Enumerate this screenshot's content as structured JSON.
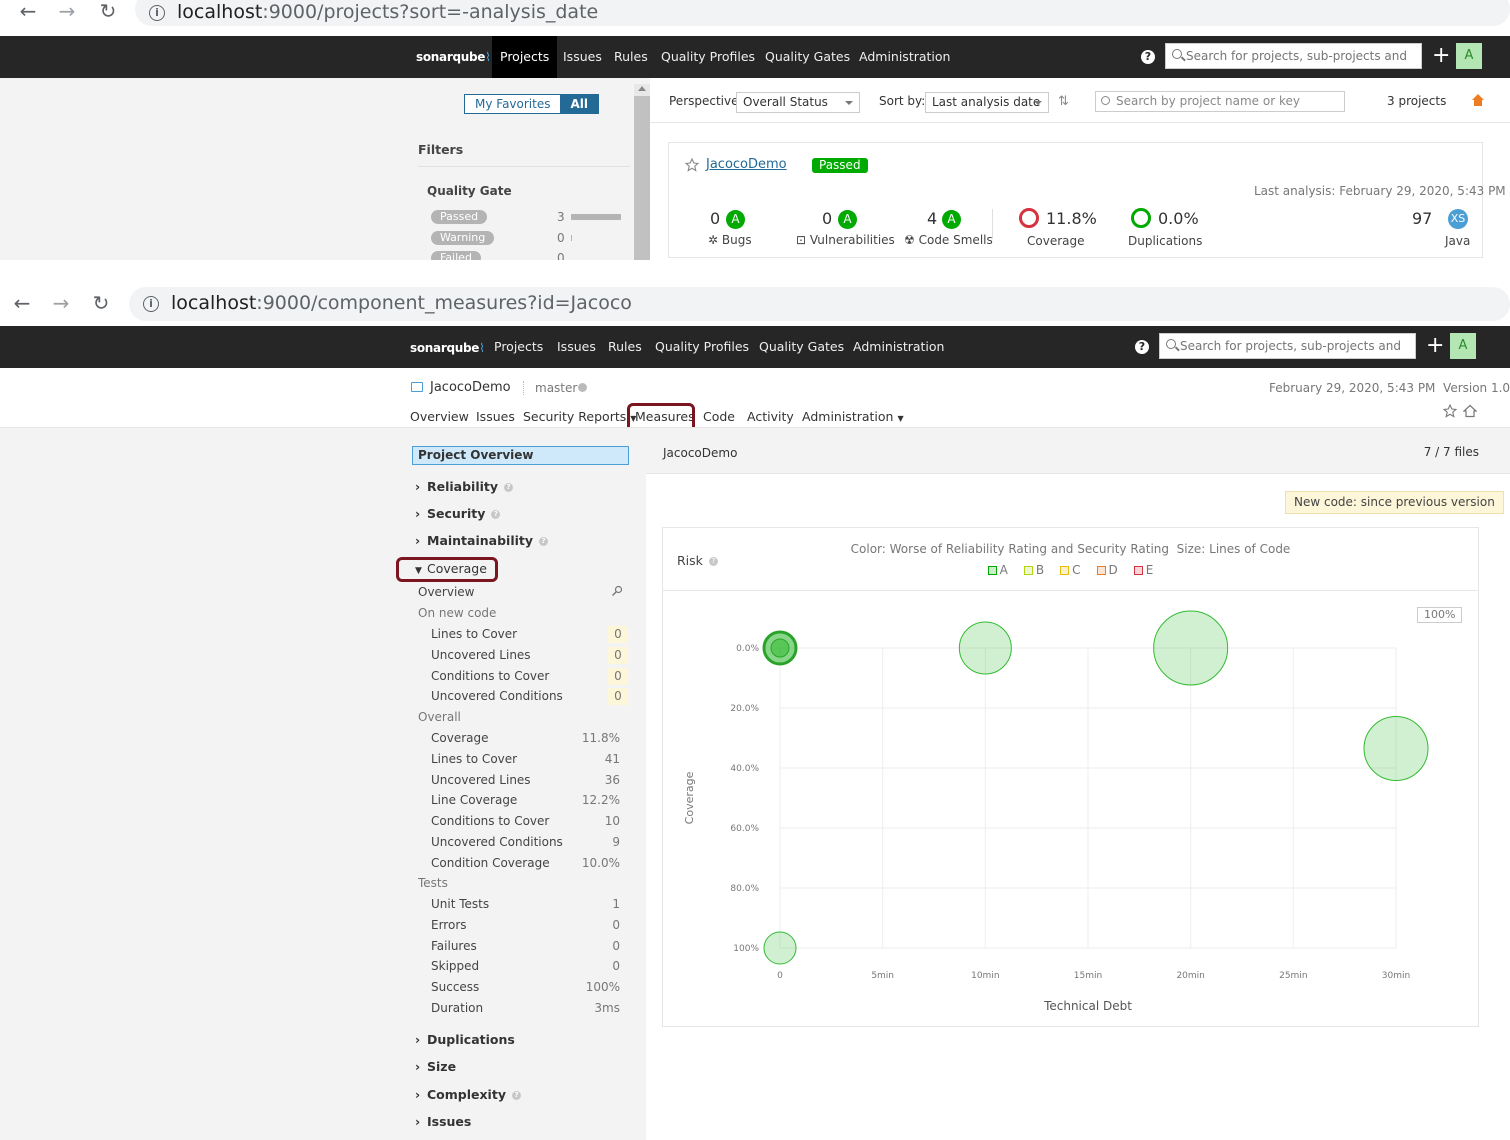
{
  "browser1": {
    "url_host": "localhost",
    "url_rest": ":9000/projects?sort=-analysis_date"
  },
  "browser2": {
    "url_host": "localhost",
    "url_rest": ":9000/component_measures?id=Jacoco"
  },
  "topnav": {
    "logo": "sonarqube",
    "items": [
      "Projects",
      "Issues",
      "Rules",
      "Quality Profiles",
      "Quality Gates",
      "Administration"
    ],
    "active": "Projects",
    "help": "?",
    "search_placeholder": "Search for projects, sub-projects and files",
    "plus": "+",
    "avatar": "A"
  },
  "projects_page": {
    "toggle": {
      "favorites": "My Favorites",
      "all": "All"
    },
    "filters_title": "Filters",
    "quality_gate_title": "Quality Gate",
    "quality_gate_filters": [
      {
        "label": "Passed",
        "count": "3"
      },
      {
        "label": "Warning",
        "count": "0"
      },
      {
        "label": "Failed",
        "count": "0"
      }
    ],
    "perspective_label": "Perspective:",
    "perspective_value": "Overall Status",
    "sort_label": "Sort by:",
    "sort_value": "Last analysis date",
    "search_placeholder": "Search by project name or key",
    "project_count": "3 projects",
    "project": {
      "name": "JacocoDemo",
      "gate": "Passed",
      "last_analysis": "Last analysis: February 29, 2020, 5:43 PM",
      "bugs": {
        "value": "0",
        "rating": "A",
        "label": "Bugs"
      },
      "vulnerabilities": {
        "value": "0",
        "rating": "A",
        "label": "Vulnerabilities"
      },
      "code_smells": {
        "value": "4",
        "rating": "A",
        "label": "Code Smells"
      },
      "coverage": {
        "value": "11.8%",
        "label": "Coverage"
      },
      "duplications": {
        "value": "0.0%",
        "label": "Duplications"
      },
      "size": {
        "value": "97",
        "badge": "XS",
        "language": "Java"
      }
    }
  },
  "measures_page": {
    "project_name": "JacocoDemo",
    "branch": "master",
    "analysis_info": "February 29, 2020, 5:43 PM  Version 1.0",
    "subnav": [
      "Overview",
      "Issues",
      "Security Reports",
      "Measures",
      "Code",
      "Activity",
      "Administration"
    ],
    "active_tab": "Measures",
    "project_overview": "Project Overview",
    "domains": {
      "reliability": "Reliability",
      "security": "Security",
      "maintainability": "Maintainability",
      "coverage": "Coverage",
      "duplications": "Duplications",
      "size": "Size",
      "complexity": "Complexity",
      "issues": "Issues"
    },
    "coverage_overview": "Overview",
    "on_new_code": "On new code",
    "new_code_metrics": [
      {
        "label": "Lines to Cover",
        "value": "0"
      },
      {
        "label": "Uncovered Lines",
        "value": "0"
      },
      {
        "label": "Conditions to Cover",
        "value": "0"
      },
      {
        "label": "Uncovered Conditions",
        "value": "0"
      }
    ],
    "overall_title": "Overall",
    "overall_metrics": [
      {
        "label": "Coverage",
        "value": "11.8%"
      },
      {
        "label": "Lines to Cover",
        "value": "41"
      },
      {
        "label": "Uncovered Lines",
        "value": "36"
      },
      {
        "label": "Line Coverage",
        "value": "12.2%"
      },
      {
        "label": "Conditions to Cover",
        "value": "10"
      },
      {
        "label": "Uncovered Conditions",
        "value": "9"
      },
      {
        "label": "Condition Coverage",
        "value": "10.0%"
      }
    ],
    "tests_title": "Tests",
    "tests_metrics": [
      {
        "label": "Unit Tests",
        "value": "1"
      },
      {
        "label": "Errors",
        "value": "0"
      },
      {
        "label": "Failures",
        "value": "0"
      },
      {
        "label": "Skipped",
        "value": "0"
      },
      {
        "label": "Success",
        "value": "100%"
      },
      {
        "label": "Duration",
        "value": "3ms"
      }
    ],
    "breadcrumb": "JacocoDemo",
    "files_count": "7 / 7 files",
    "new_code_badge": "New code: since previous version",
    "risk_title": "Risk",
    "legend_caption": "Color: Worse of Reliability Rating and Security Rating  Size: Lines of Code",
    "legend_items": [
      "A",
      "B",
      "C",
      "D",
      "E"
    ],
    "legend_colors": [
      "#00aa00",
      "#b0d513",
      "#eabe06",
      "#ed7d20",
      "#d4333f"
    ],
    "zoom": "100%"
  },
  "chart_data": {
    "type": "scatter",
    "title": "Risk",
    "xlabel": "Technical Debt",
    "ylabel": "Coverage",
    "x_ticks": [
      "0",
      "5min",
      "10min",
      "15min",
      "20min",
      "25min",
      "30min"
    ],
    "y_ticks": [
      "0.0%",
      "20.0%",
      "40.0%",
      "60.0%",
      "80.0%",
      "100%"
    ],
    "xlim": [
      0,
      30
    ],
    "ylim": [
      0,
      100
    ],
    "y_reversed": true,
    "grid": true,
    "points": [
      {
        "x": 0,
        "y": 0,
        "size_rank": 1,
        "rating": "A",
        "highlighted": true
      },
      {
        "x": 10,
        "y": 0,
        "size_rank": 3,
        "rating": "A"
      },
      {
        "x": 20,
        "y": 0,
        "size_rank": 5,
        "rating": "A"
      },
      {
        "x": 30,
        "y": 33.5,
        "size_rank": 4,
        "rating": "A"
      },
      {
        "x": 0,
        "y": 100,
        "size_rank": 1,
        "rating": "A"
      }
    ]
  }
}
